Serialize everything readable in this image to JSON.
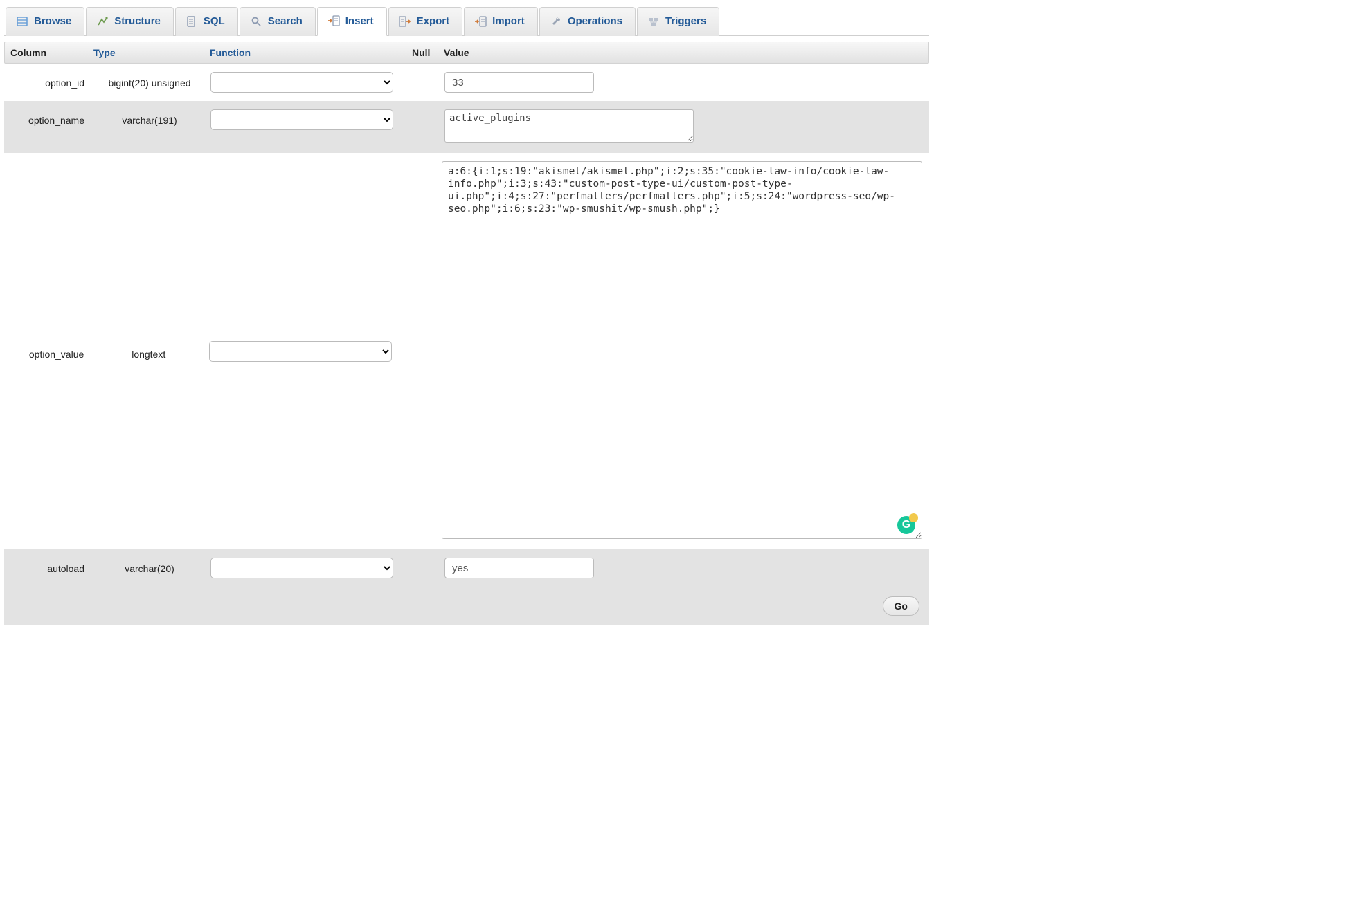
{
  "tabs": [
    {
      "label": "Browse",
      "icon": "browse-icon"
    },
    {
      "label": "Structure",
      "icon": "structure-icon"
    },
    {
      "label": "SQL",
      "icon": "sql-icon"
    },
    {
      "label": "Search",
      "icon": "search-icon"
    },
    {
      "label": "Insert",
      "icon": "insert-icon",
      "active": true
    },
    {
      "label": "Export",
      "icon": "export-icon"
    },
    {
      "label": "Import",
      "icon": "import-icon"
    },
    {
      "label": "Operations",
      "icon": "operations-icon"
    },
    {
      "label": "Triggers",
      "icon": "triggers-icon"
    }
  ],
  "headers": {
    "column": "Column",
    "type": "Type",
    "function": "Function",
    "null": "Null",
    "value": "Value"
  },
  "rows": [
    {
      "column": "option_id",
      "type": "bigint(20) unsigned",
      "value": "33",
      "input": "text"
    },
    {
      "column": "option_name",
      "type": "varchar(191)",
      "value": "active_plugins",
      "input": "textarea-small"
    },
    {
      "column": "option_value",
      "type": "longtext",
      "value": "a:6:{i:1;s:19:\"akismet/akismet.php\";i:2;s:35:\"cookie-law-info/cookie-law-info.php\";i:3;s:43:\"custom-post-type-ui/custom-post-type-ui.php\";i:4;s:27:\"perfmatters/perfmatters.php\";i:5;s:24:\"wordpress-seo/wp-seo.php\";i:6;s:23:\"wp-smushit/wp-smush.php\";}",
      "input": "textarea-large"
    },
    {
      "column": "autoload",
      "type": "varchar(20)",
      "value": "yes",
      "input": "text"
    }
  ],
  "actions": {
    "go": "Go"
  },
  "grammarly_badge": "G"
}
